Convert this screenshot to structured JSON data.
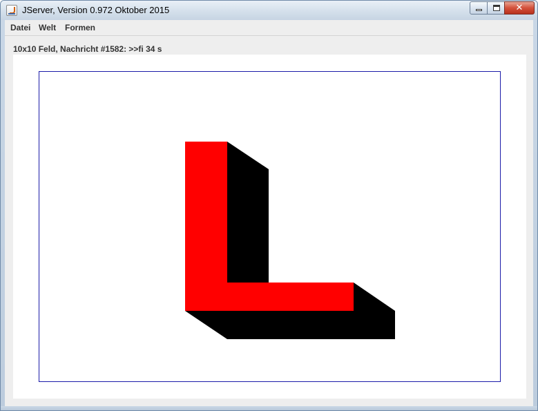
{
  "window": {
    "title": "JServer, Version 0.972 Oktober 2015",
    "controls": {
      "minimize": "minimize",
      "maximize": "maximize",
      "close": "✕"
    }
  },
  "menubar": {
    "items": [
      {
        "label": "Datei"
      },
      {
        "label": "Welt"
      },
      {
        "label": "Formen"
      }
    ]
  },
  "status": {
    "text": "10x10 Feld, Nachricht #1582: >>fi 34 s"
  },
  "board": {
    "border_color": "#1a1aa8",
    "shape": {
      "name": "letter-L",
      "face_color": "#ff0000",
      "shadow_color": "#000000"
    }
  }
}
